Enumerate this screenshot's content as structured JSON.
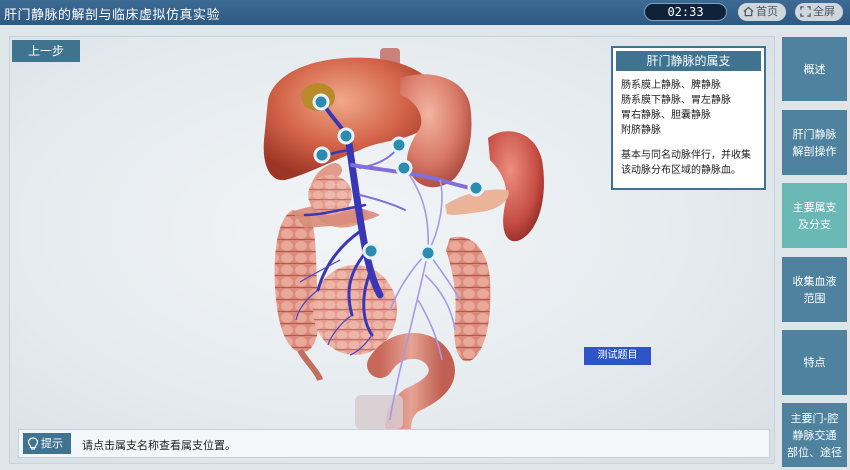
{
  "app": {
    "title": "肝门静脉的解剖与临床虚拟仿真实验",
    "timer": "02:33"
  },
  "topbar": {
    "home_label": "首页",
    "fullscreen_label": "全屏"
  },
  "stage": {
    "back_label": "上一步",
    "test_label": "测试题目"
  },
  "info": {
    "title": "肝门静脉的属支",
    "branches": [
      "肠系膜上静脉、脾静脉",
      "肠系膜下静脉、胃左静脉",
      "胃右静脉、胆囊静脉",
      "附脐静脉"
    ],
    "desc_lines": [
      "基本与同名动脉伴行，并收集",
      "该动脉分布区域的静脉血。"
    ]
  },
  "nav": [
    {
      "label_lines": [
        "概述"
      ],
      "active": false
    },
    {
      "label_lines": [
        "肝门静脉",
        "解剖操作"
      ],
      "active": false
    },
    {
      "label_lines": [
        "主要属支",
        "及分支"
      ],
      "active": true
    },
    {
      "label_lines": [
        "收集血液",
        "范围"
      ],
      "active": false
    },
    {
      "label_lines": [
        "特点"
      ],
      "active": false
    },
    {
      "label_lines": [
        "主要门-腔",
        "静脉交通",
        "部位、途径"
      ],
      "active": false
    }
  ],
  "hint": {
    "tag": "提示",
    "text": "请点击属支名称查看属支位置。"
  },
  "colors": {
    "primary": "#3f7390",
    "active": "#6ab9b7",
    "test_button": "#2d55c8",
    "timer_bg": "#0f2237"
  },
  "icons": {
    "home": "home-icon",
    "fullscreen": "fullscreen-icon",
    "hint": "lightbulb-icon",
    "marker": "location-marker-icon"
  }
}
